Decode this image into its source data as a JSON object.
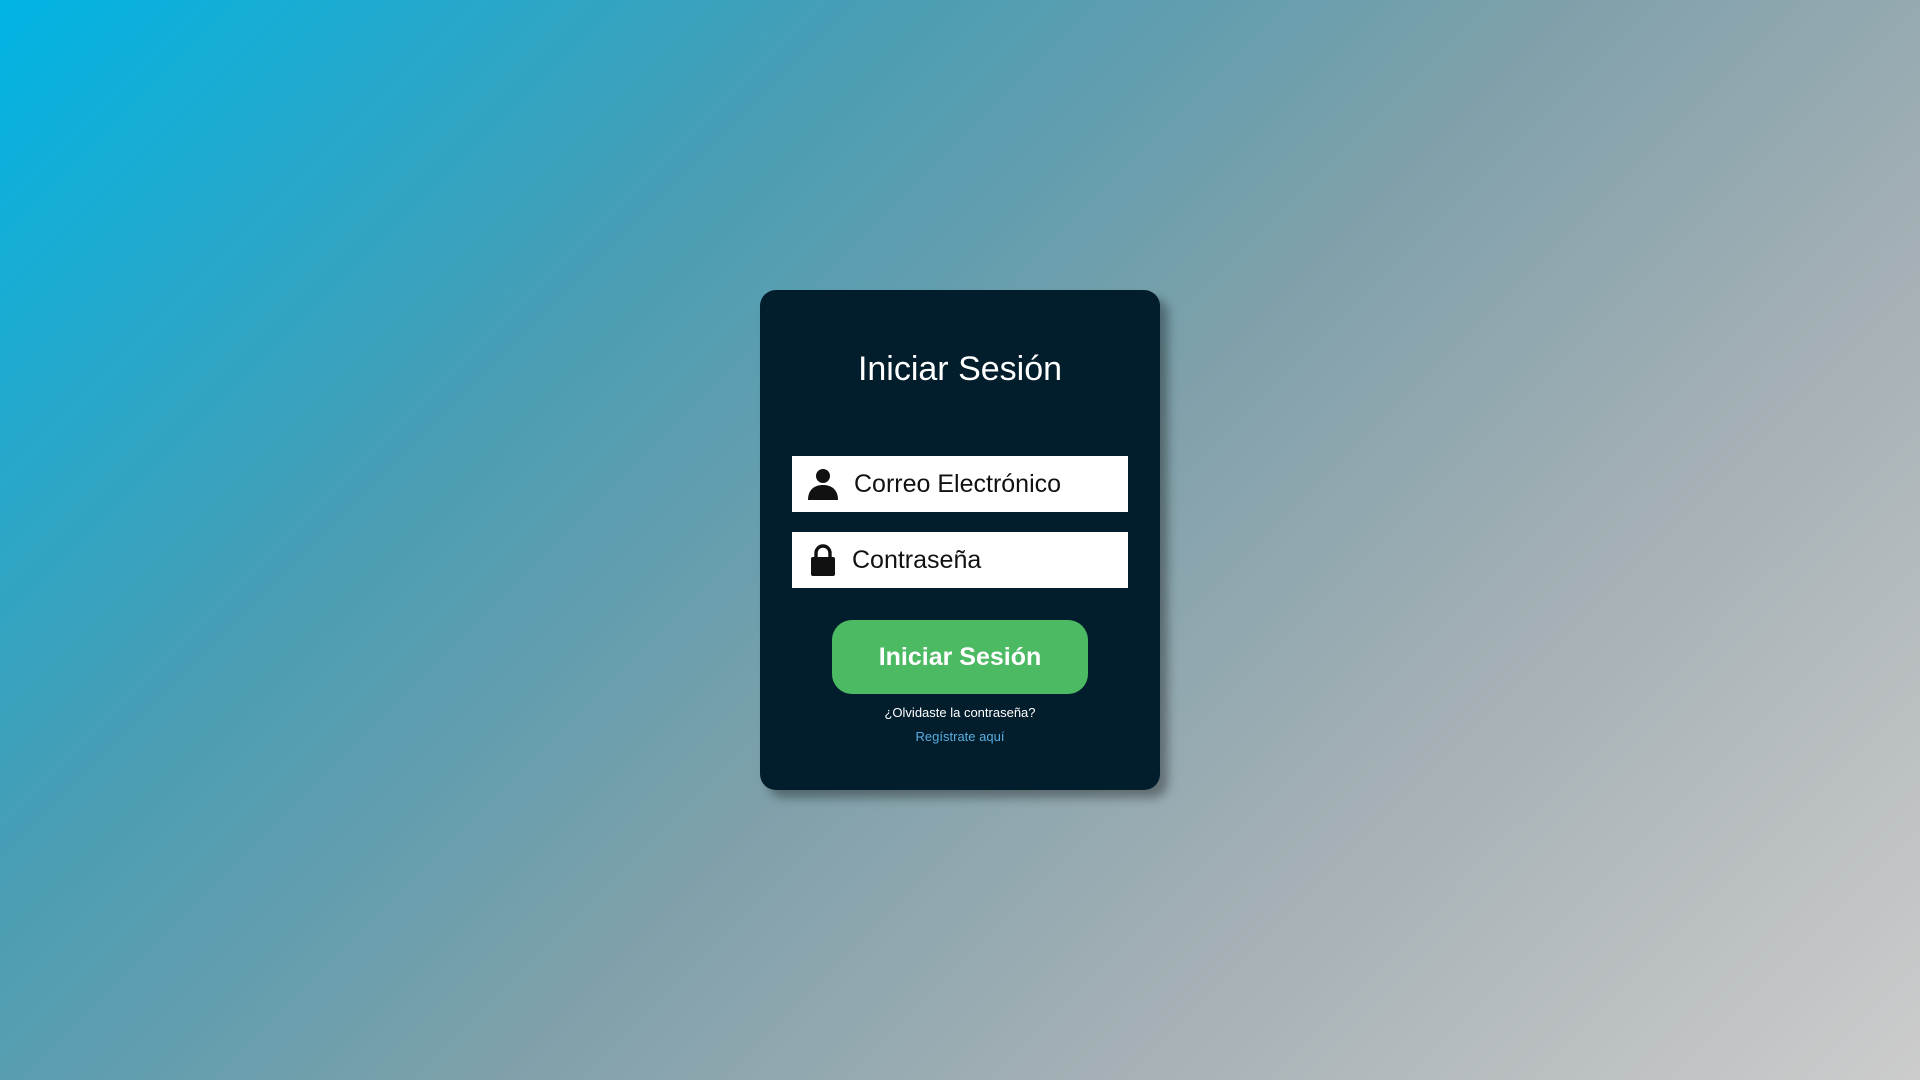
{
  "login": {
    "title": "Iniciar Sesión",
    "email_placeholder": "Correo Electrónico",
    "password_placeholder": "Contraseña",
    "submit_label": "Iniciar Sesión",
    "forgot_label": "¿Olvidaste la contraseña?",
    "register_label": "Regístrate aquí"
  },
  "icons": {
    "email": "user-icon",
    "password": "lock-icon"
  },
  "colors": {
    "card_background": "#021d2c",
    "button": "#4cb963",
    "link": "#5aaee0",
    "gradient_start": "#00b4e4",
    "gradient_end": "#cccccc"
  }
}
